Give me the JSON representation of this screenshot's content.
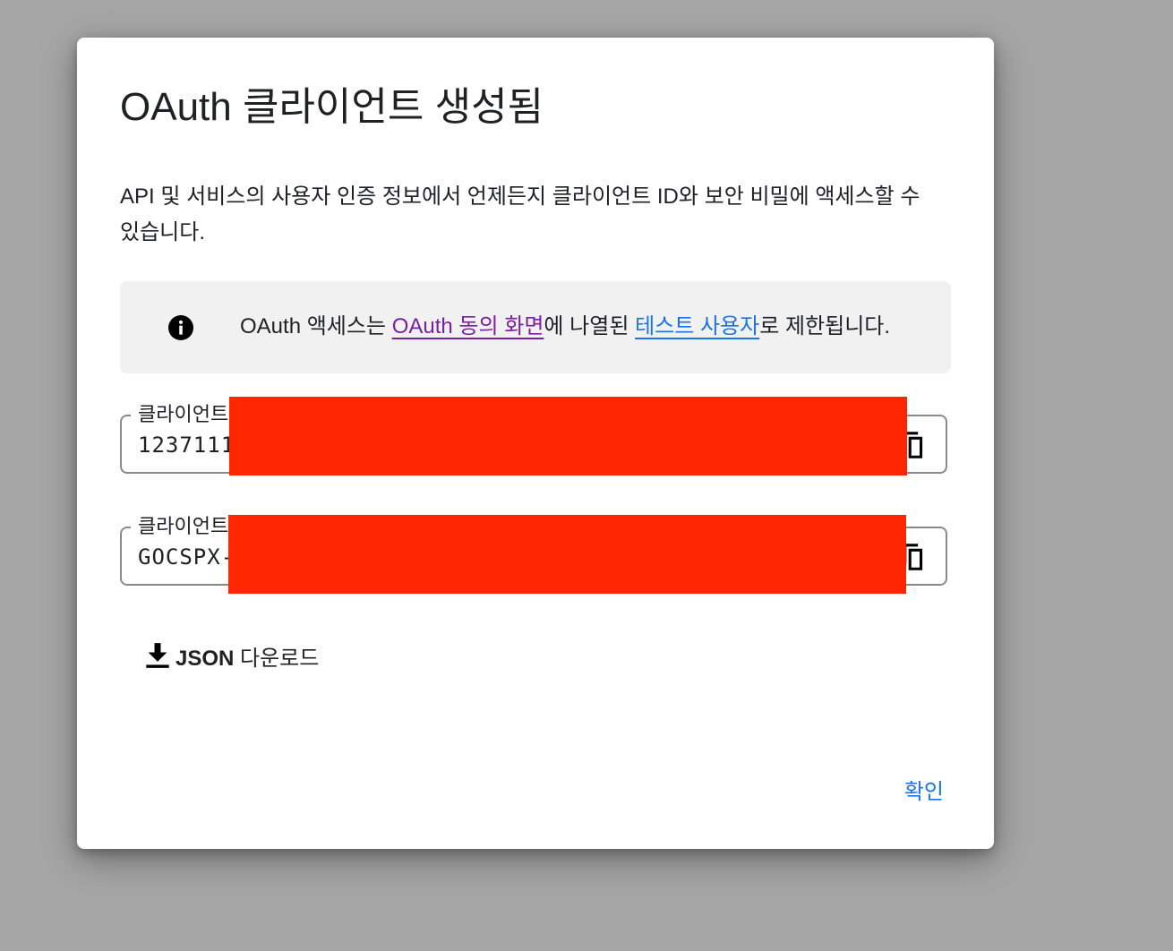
{
  "dialog": {
    "title": "OAuth 클라이언트 생성됨",
    "description": "API 및 서비스의 사용자 인증 정보에서 언제든지 클라이언트 ID와 보안 비밀에 액세스할 수 있습니다.",
    "info": {
      "icon": "info-icon",
      "text_before": "OAuth 액세스는 ",
      "consent_link": "OAuth 동의 화면",
      "text_middle": "에 나열된 ",
      "test_users_link": "테스트 사용자",
      "text_after": "로 제한됩니다."
    },
    "client_id": {
      "label": "클라이언트",
      "value": "1237111"
    },
    "client_secret": {
      "label": "클라이언트",
      "value": "GOCSPX-"
    },
    "download": {
      "label_bold": "JSON",
      "label_rest": " 다운로드",
      "icon": "download-icon"
    },
    "ok_button": "확인",
    "colors": {
      "link_visited": "#7b1fa2",
      "link": "#1a73e8",
      "redaction": "#ff2600",
      "info_bg": "#f1f1f1"
    }
  }
}
